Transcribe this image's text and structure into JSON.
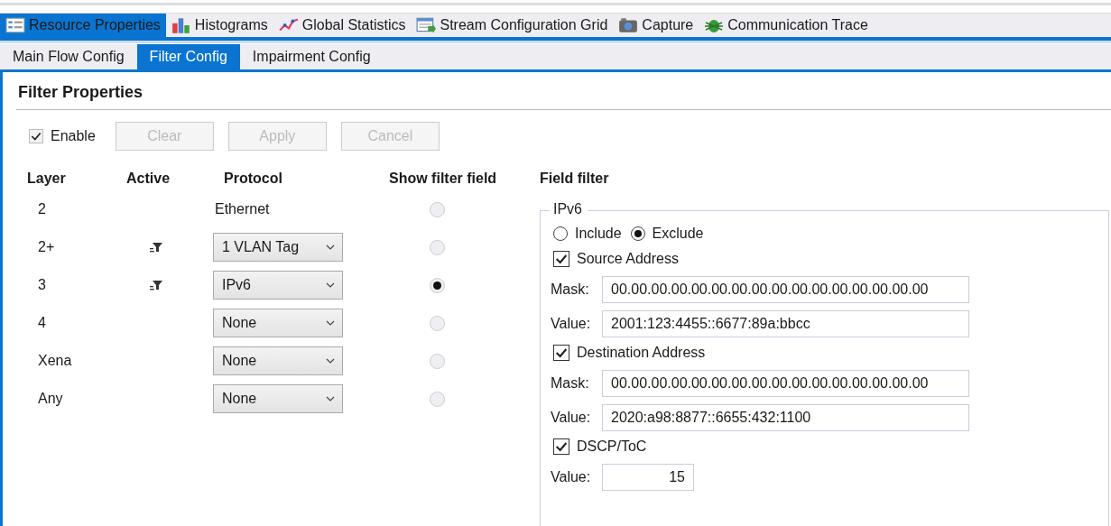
{
  "main_tabs": [
    {
      "label": "Resource Properties",
      "selected": true
    },
    {
      "label": "Histograms",
      "selected": false
    },
    {
      "label": "Global Statistics",
      "selected": false
    },
    {
      "label": "Stream Configuration Grid",
      "selected": false
    },
    {
      "label": "Capture",
      "selected": false
    },
    {
      "label": "Communication Trace",
      "selected": false
    }
  ],
  "sub_tabs": [
    {
      "label": "Main Flow Config",
      "selected": false
    },
    {
      "label": "Filter Config",
      "selected": true
    },
    {
      "label": "Impairment Config",
      "selected": false
    }
  ],
  "panel": {
    "title": "Filter Properties",
    "enable": {
      "label": "Enable",
      "checked": true
    },
    "buttons": [
      {
        "label": "Clear",
        "disabled": true
      },
      {
        "label": "Apply",
        "disabled": true
      },
      {
        "label": "Cancel",
        "disabled": true
      }
    ],
    "columns": [
      "Layer",
      "Active",
      "Protocol",
      "Show filter field",
      "Field filter"
    ],
    "rows": [
      {
        "layer": "2",
        "active": false,
        "protocol": {
          "kind": "text",
          "value": "Ethernet"
        },
        "selected": false
      },
      {
        "layer": "2+",
        "active": true,
        "protocol": {
          "kind": "dropdown",
          "value": "1 VLAN Tag"
        },
        "selected": false
      },
      {
        "layer": "3",
        "active": true,
        "protocol": {
          "kind": "dropdown",
          "value": "IPv6"
        },
        "selected": true
      },
      {
        "layer": "4",
        "active": false,
        "protocol": {
          "kind": "dropdown",
          "value": "None"
        },
        "selected": false
      },
      {
        "layer": "Xena",
        "active": false,
        "protocol": {
          "kind": "dropdown",
          "value": "None"
        },
        "selected": false
      },
      {
        "layer": "Any",
        "active": false,
        "protocol": {
          "kind": "dropdown",
          "value": "None"
        },
        "selected": false
      }
    ],
    "field_filter": {
      "group": "IPv6",
      "modes": [
        {
          "label": "Include",
          "selected": false
        },
        {
          "label": "Exclude",
          "selected": true
        }
      ],
      "fields": [
        {
          "label": "Source Address",
          "checked": true,
          "kind": "address",
          "entries": [
            {
              "label": "Mask:",
              "value": "00.00.00.00.00.00.00.00.00.00.00.00.00.00.00.00"
            },
            {
              "label": "Value:",
              "value": "2001:123:4455::6677:89a:bbcc"
            }
          ]
        },
        {
          "label": "Destination Address",
          "checked": true,
          "kind": "address",
          "entries": [
            {
              "label": "Mask:",
              "value": "00.00.00.00.00.00.00.00.00.00.00.00.00.00.00.00"
            },
            {
              "label": "Value:",
              "value": "2020:a98:8877::6655:432:1100"
            }
          ]
        },
        {
          "label": "DSCP/ToC",
          "checked": true,
          "kind": "number",
          "entries": [
            {
              "label": "Value:",
              "value": "15"
            }
          ]
        }
      ]
    }
  }
}
